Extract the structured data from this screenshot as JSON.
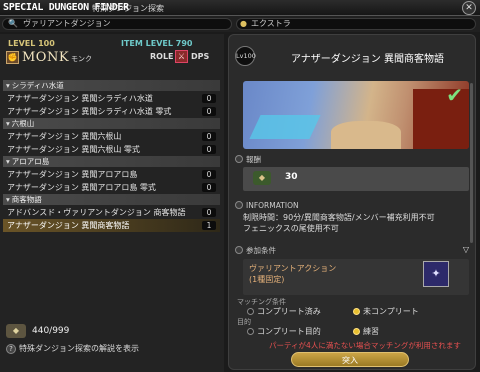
{
  "window": {
    "title": "SPECIAL DUNGEON FINDER",
    "subtitle": "特殊ダンジョン探索",
    "close_glyph": "✕"
  },
  "search": {
    "value": "ヴァリアントダンジョン",
    "icon": "search-icon",
    "icon_glyph": "🔍"
  },
  "extra": {
    "label": "エクストラ",
    "icon": "magnifier-icon",
    "icon_glyph": "●"
  },
  "character": {
    "level": "LEVEL 100",
    "item_level": "ITEM LEVEL 790",
    "job": "MONK",
    "job_jp": "モンク",
    "job_glyph": "✊",
    "role_label": "ROLE",
    "role_glyph": "⚔",
    "role": "DPS"
  },
  "categories": [
    {
      "name": "シラディハ水道",
      "rows": [
        {
          "label": "アナザーダンジョン 異聞シラディハ水道",
          "count": "0"
        },
        {
          "label": "アナザーダンジョン 異聞シラディハ水道 零式",
          "count": "0"
        }
      ]
    },
    {
      "name": "六根山",
      "rows": [
        {
          "label": "アナザーダンジョン 異聞六根山",
          "count": "0"
        },
        {
          "label": "アナザーダンジョン 異聞六根山 零式",
          "count": "0"
        }
      ]
    },
    {
      "name": "アロアロ島",
      "rows": [
        {
          "label": "アナザーダンジョン 異聞アロアロ島",
          "count": "0"
        },
        {
          "label": "アナザーダンジョン 異聞アロアロ島 零式",
          "count": "0"
        }
      ]
    },
    {
      "name": "商客物語",
      "rows": [
        {
          "label": "アドバンスド・ヴァリアントダンジョン 商客物語",
          "count": "0"
        },
        {
          "label": "アナザーダンジョン 異聞商客物語",
          "count": "1"
        }
      ]
    }
  ],
  "tomestones": {
    "count": "440/999",
    "glyph": "◆"
  },
  "help": {
    "label": "特殊ダンジョン探索の解説を表示",
    "glyph": "?"
  },
  "detail": {
    "level_badge": "Lv100",
    "title": "アナザーダンジョン 異聞商客物語",
    "check_glyph": "✔",
    "reward_label": "報酬",
    "reward_count": "30",
    "reward_glyph": "◆",
    "info_label": "INFORMATION",
    "info_lines": [
      "制限時間：90分/異聞商客物語/メンバー補充利用不可",
      "フェニックスの尾使用不可"
    ],
    "cond_label": "参加条件",
    "cond_name": "ヴァリアントアクション",
    "cond_sub": "(1種固定)",
    "cond_glyph": "✦",
    "matching_label": "マッチング条件",
    "opt_complete": "コンプリート済み",
    "opt_incomplete": "未コンプリート",
    "goal_label": "目的",
    "opt_goal_complete": "コンプリート目的",
    "opt_practice": "練習",
    "warning": "パーティが4人に満たない場合マッチングが利用されます",
    "join_label": "突入",
    "collapse_glyph": "▽"
  }
}
